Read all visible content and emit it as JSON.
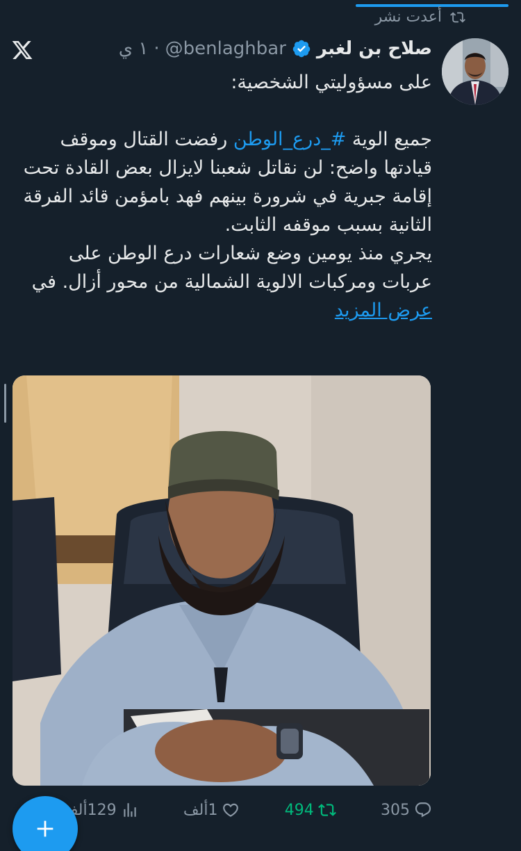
{
  "retweet_label": "أعدت نشر",
  "tweet": {
    "author_name": "صلاح بن لغبر",
    "handle": "@benlaghbar",
    "separator": "·",
    "time": "١ ي",
    "line_intro": "على مسؤوليتي الشخصية:",
    "para1_prefix": "جميع الوية ",
    "hashtag": "#_درع_الوطن",
    "para1_rest": " رفضت  القتال وموقف قيادتها واضح: لن نقاتل شعبنا لايزال بعض القادة تحت إقامة جبرية في شرورة بينهم فهد بامؤمن قائد الفرقة الثانية بسبب موقفه الثابت.",
    "para2_prefix": "يجري منذ يومين وضع شعارات درع الوطن على عربات ومركبات الالوية الشمالية من محور أزال. في ",
    "show_more": "عرض المزيد"
  },
  "metrics": {
    "replies": "305",
    "retweets": "494",
    "likes": "1ألف",
    "views": "129ألف"
  },
  "colors": {
    "background": "#15202b",
    "accent": "#1d9bf0",
    "retweet_green": "#00ba7c",
    "muted": "#8b98a5"
  },
  "icons": [
    "retweet-icon",
    "x-logo-icon",
    "verified-icon",
    "reply-icon",
    "like-icon",
    "views-icon",
    "plus-icon"
  ]
}
